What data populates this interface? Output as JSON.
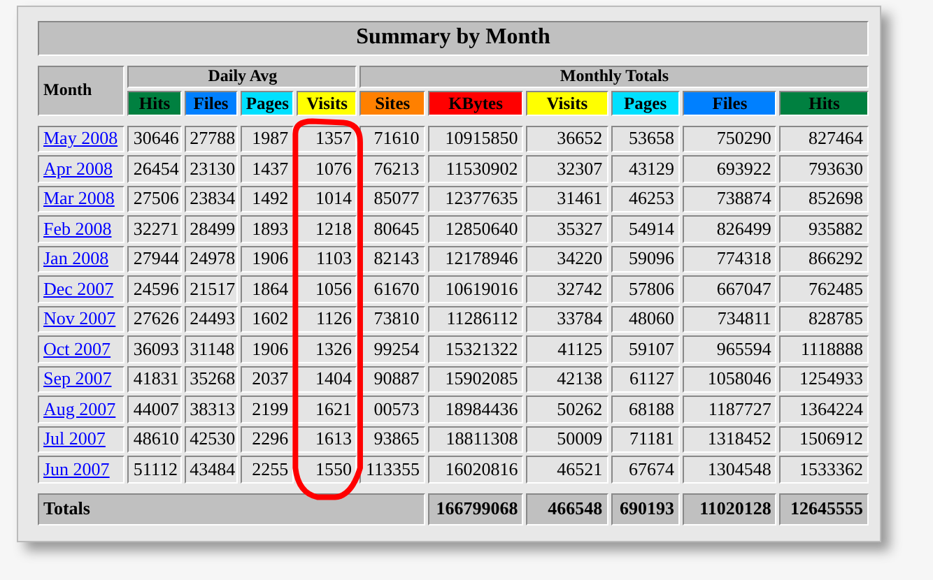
{
  "title": "Summary by Month",
  "month_header": "Month",
  "groups": [
    {
      "label": "Daily Avg",
      "columns": [
        {
          "label": "Hits",
          "color": "#008040",
          "circled": false
        },
        {
          "label": "Files",
          "color": "#0080ff",
          "circled": false
        },
        {
          "label": "Pages",
          "color": "#00e0ff",
          "circled": false
        },
        {
          "label": "Visits",
          "color": "#ffff00",
          "circled": true
        }
      ]
    },
    {
      "label": "Monthly Totals",
      "columns": [
        {
          "label": "Sites",
          "color": "#ff8000",
          "circled": false
        },
        {
          "label": "KBytes",
          "color": "#ff0000",
          "circled": false
        },
        {
          "label": "Visits",
          "color": "#ffff00",
          "circled": false
        },
        {
          "label": "Pages",
          "color": "#00e0ff",
          "circled": false
        },
        {
          "label": "Files",
          "color": "#0080ff",
          "circled": false
        },
        {
          "label": "Hits",
          "color": "#008040",
          "circled": false
        }
      ]
    }
  ],
  "rows": [
    {
      "month": "May 2008",
      "values": [
        "30646",
        "27788",
        "1987",
        "1357",
        "71610",
        "10915850",
        "36652",
        "53658",
        "750290",
        "827464"
      ]
    },
    {
      "month": "Apr 2008",
      "values": [
        "26454",
        "23130",
        "1437",
        "1076",
        "76213",
        "11530902",
        "32307",
        "43129",
        "693922",
        "793630"
      ]
    },
    {
      "month": "Mar 2008",
      "values": [
        "27506",
        "23834",
        "1492",
        "1014",
        "85077",
        "12377635",
        "31461",
        "46253",
        "738874",
        "852698"
      ]
    },
    {
      "month": "Feb 2008",
      "values": [
        "32271",
        "28499",
        "1893",
        "1218",
        "80645",
        "12850640",
        "35327",
        "54914",
        "826499",
        "935882"
      ]
    },
    {
      "month": "Jan 2008",
      "values": [
        "27944",
        "24978",
        "1906",
        "1103",
        "82143",
        "12178946",
        "34220",
        "59096",
        "774318",
        "866292"
      ]
    },
    {
      "month": "Dec 2007",
      "values": [
        "24596",
        "21517",
        "1864",
        "1056",
        "61670",
        "10619016",
        "32742",
        "57806",
        "667047",
        "762485"
      ]
    },
    {
      "month": "Nov 2007",
      "values": [
        "27626",
        "24493",
        "1602",
        "1126",
        "73810",
        "11286112",
        "33784",
        "48060",
        "734811",
        "828785"
      ]
    },
    {
      "month": "Oct 2007",
      "values": [
        "36093",
        "31148",
        "1906",
        "1326",
        "99254",
        "15321322",
        "41125",
        "59107",
        "965594",
        "1118888"
      ]
    },
    {
      "month": "Sep 2007",
      "values": [
        "41831",
        "35268",
        "2037",
        "1404",
        "90887",
        "15902085",
        "42138",
        "61127",
        "1058046",
        "1254933"
      ]
    },
    {
      "month": "Aug 2007",
      "values": [
        "44007",
        "38313",
        "2199",
        "1621",
        "00573",
        "18984436",
        "50262",
        "68188",
        "1187727",
        "1364224"
      ]
    },
    {
      "month": "Jul 2007",
      "values": [
        "48610",
        "42530",
        "2296",
        "1613",
        "93865",
        "18811308",
        "50009",
        "71181",
        "1318452",
        "1506912"
      ]
    },
    {
      "month": "Jun 2007",
      "values": [
        "51112",
        "43484",
        "2255",
        "1550",
        "113355",
        "16020816",
        "46521",
        "67674",
        "1304548",
        "1533362"
      ]
    }
  ],
  "totals": {
    "label": "Totals",
    "values": [
      "166799068",
      "466548",
      "690193",
      "11020128",
      "12645555"
    ]
  }
}
